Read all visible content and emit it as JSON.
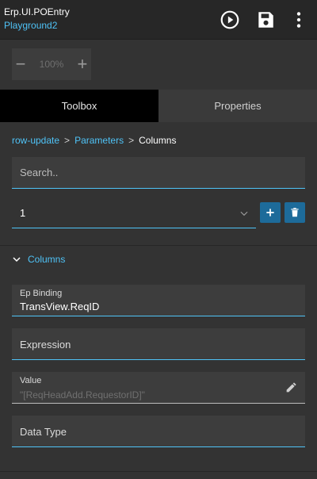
{
  "header": {
    "title": "Erp.UI.POEntry",
    "subtitle": "Playground2",
    "icons": [
      "play-circle-icon",
      "save-icon",
      "more-vertical-icon"
    ]
  },
  "zoom": {
    "minus": "−",
    "value": "100%",
    "plus": "+"
  },
  "tabs": [
    {
      "label": "Toolbox",
      "active": true
    },
    {
      "label": "Properties",
      "active": false
    }
  ],
  "breadcrumb": {
    "items": [
      "row-update",
      "Parameters",
      "Columns"
    ],
    "separator": ">"
  },
  "search": {
    "placeholder": "Search.."
  },
  "selector": {
    "value": "1"
  },
  "section": {
    "label": "Columns"
  },
  "fields": {
    "ep_binding": {
      "label": "Ep Binding",
      "value": "TransView.ReqID"
    },
    "expression": {
      "label": "Expression"
    },
    "value": {
      "label": "Value",
      "value": "\"[ReqHeadAdd.RequestorID]\""
    },
    "data_type": {
      "label": "Data Type"
    }
  },
  "colors": {
    "accent": "#4fc3f7",
    "button": "#1d6b9a",
    "background": "#333333"
  }
}
